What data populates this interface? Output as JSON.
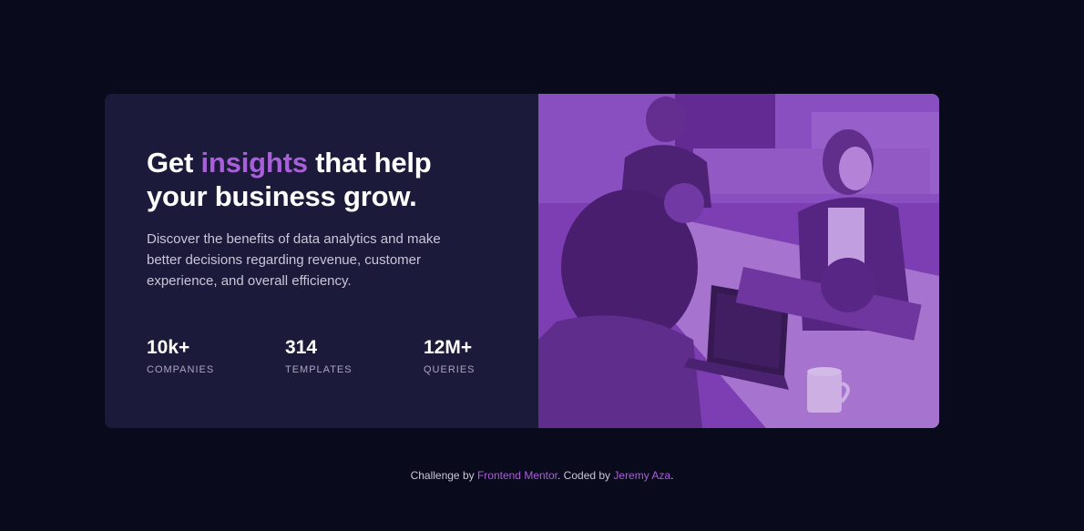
{
  "hero": {
    "headline_before": "Get ",
    "headline_accent": "insights",
    "headline_after": " that help your business grow.",
    "description": "Discover the benefits of data analytics and make better decisions regarding revenue, customer experience, and overall efficiency."
  },
  "stats": [
    {
      "value": "10k+",
      "label": "COMPANIES"
    },
    {
      "value": "314",
      "label": "TEMPLATES"
    },
    {
      "value": "12M+",
      "label": "QUERIES"
    }
  ],
  "footer": {
    "prefix": "Challenge by ",
    "link1": "Frontend Mentor",
    "middle": ". Coded by ",
    "link2": "Jeremy Aza",
    "suffix": "."
  },
  "colors": {
    "background": "#090a1c",
    "card": "#1c1a3a",
    "accent": "#a95fd9",
    "photo_overlay": "#7a3bb0"
  },
  "image": {
    "name": "office-team-photo"
  }
}
